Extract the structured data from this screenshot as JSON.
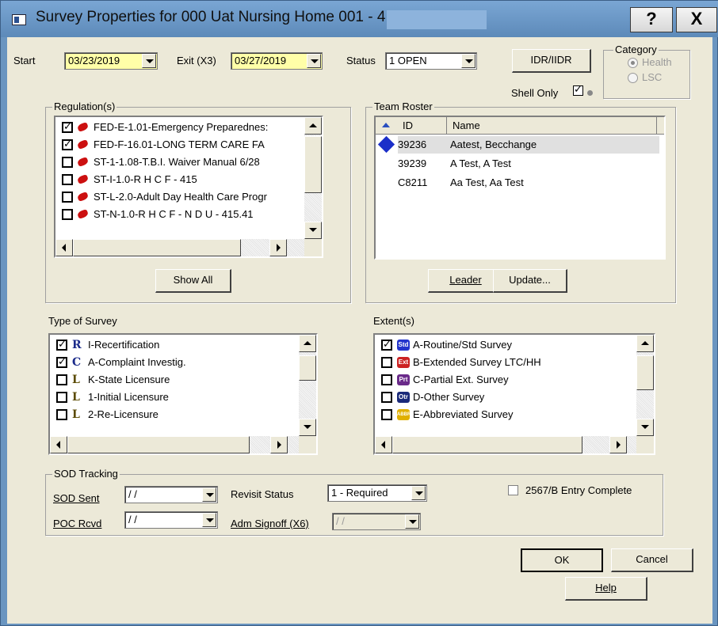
{
  "window": {
    "title": "Survey Properties for 000 Uat Nursing Home 001 - 4",
    "help_glyph": "?",
    "close_glyph": "X"
  },
  "header": {
    "start_label": "Start",
    "start_value": "03/23/2019",
    "exit_label": "Exit (X3)",
    "exit_value": "03/27/2019",
    "status_label": "Status",
    "status_value": "1  OPEN",
    "idr_button": "IDR/IIDR",
    "shell_only_label": "Shell Only",
    "shell_only_checked": true
  },
  "category": {
    "label": "Category",
    "options": [
      "Health",
      "LSC"
    ],
    "selected": "Health"
  },
  "regulations": {
    "label": "Regulation(s)",
    "items": [
      {
        "checked": true,
        "text": "FED-E-1.01-Emergency Preparednes:"
      },
      {
        "checked": true,
        "text": "FED-F-16.01-LONG TERM CARE FA"
      },
      {
        "checked": false,
        "text": "ST-1-1.08-T.B.I. Waiver Manual 6/28"
      },
      {
        "checked": false,
        "text": "ST-I-1.0-R H C F - 415"
      },
      {
        "checked": false,
        "text": "ST-L-2.0-Adult Day Health Care Progr"
      },
      {
        "checked": false,
        "text": "ST-N-1.0-R H C F - N D U - 415.41"
      }
    ],
    "show_all_button": "Show All"
  },
  "team_roster": {
    "label": "Team Roster",
    "columns": [
      "ID",
      "Name"
    ],
    "rows": [
      {
        "id": "39236",
        "name": "Aatest, Becchange",
        "leader": true
      },
      {
        "id": "39239",
        "name": "A Test, A Test",
        "leader": false
      },
      {
        "id": "C8211",
        "name": "Aa Test, Aa Test",
        "leader": false
      }
    ],
    "leader_button": "Leader",
    "update_button": "Update..."
  },
  "type_of_survey": {
    "label": "Type of Survey",
    "items": [
      {
        "checked": true,
        "icon": "R",
        "text": "I-Recertification"
      },
      {
        "checked": true,
        "icon": "C",
        "text": "A-Complaint Investig."
      },
      {
        "checked": false,
        "icon": "L",
        "text": "K-State Licensure"
      },
      {
        "checked": false,
        "icon": "L",
        "text": "1-Initial Licensure"
      },
      {
        "checked": false,
        "icon": "L",
        "text": "2-Re-Licensure"
      }
    ]
  },
  "extents": {
    "label": "Extent(s)",
    "items": [
      {
        "checked": true,
        "badge": "Std",
        "color": "#2233cc",
        "text": "A-Routine/Std Survey"
      },
      {
        "checked": false,
        "badge": "Ext",
        "color": "#cc2222",
        "text": "B-Extended Survey LTC/HH"
      },
      {
        "checked": false,
        "badge": "Prt",
        "color": "#6a2a8a",
        "text": "C-Partial Ext. Survey"
      },
      {
        "checked": false,
        "badge": "Otr",
        "color": "#1a2a7a",
        "text": "D-Other Survey"
      },
      {
        "checked": false,
        "badge": "ABBR",
        "color": "#e0b000",
        "text": "E-Abbreviated Survey"
      }
    ]
  },
  "sod": {
    "label": "SOD Tracking",
    "sod_sent_label": "SOD Sent",
    "sod_sent_value": " / /",
    "poc_rcvd_label": "POC Rcvd",
    "poc_rcvd_value": " / /",
    "revisit_label": "Revisit Status",
    "revisit_value": "1 - Required",
    "adm_label": "Adm Signoff (X6)",
    "adm_value": " / /",
    "entry_complete_label": "2567/B Entry Complete"
  },
  "footer": {
    "ok": "OK",
    "cancel": "Cancel",
    "help": "Help"
  }
}
